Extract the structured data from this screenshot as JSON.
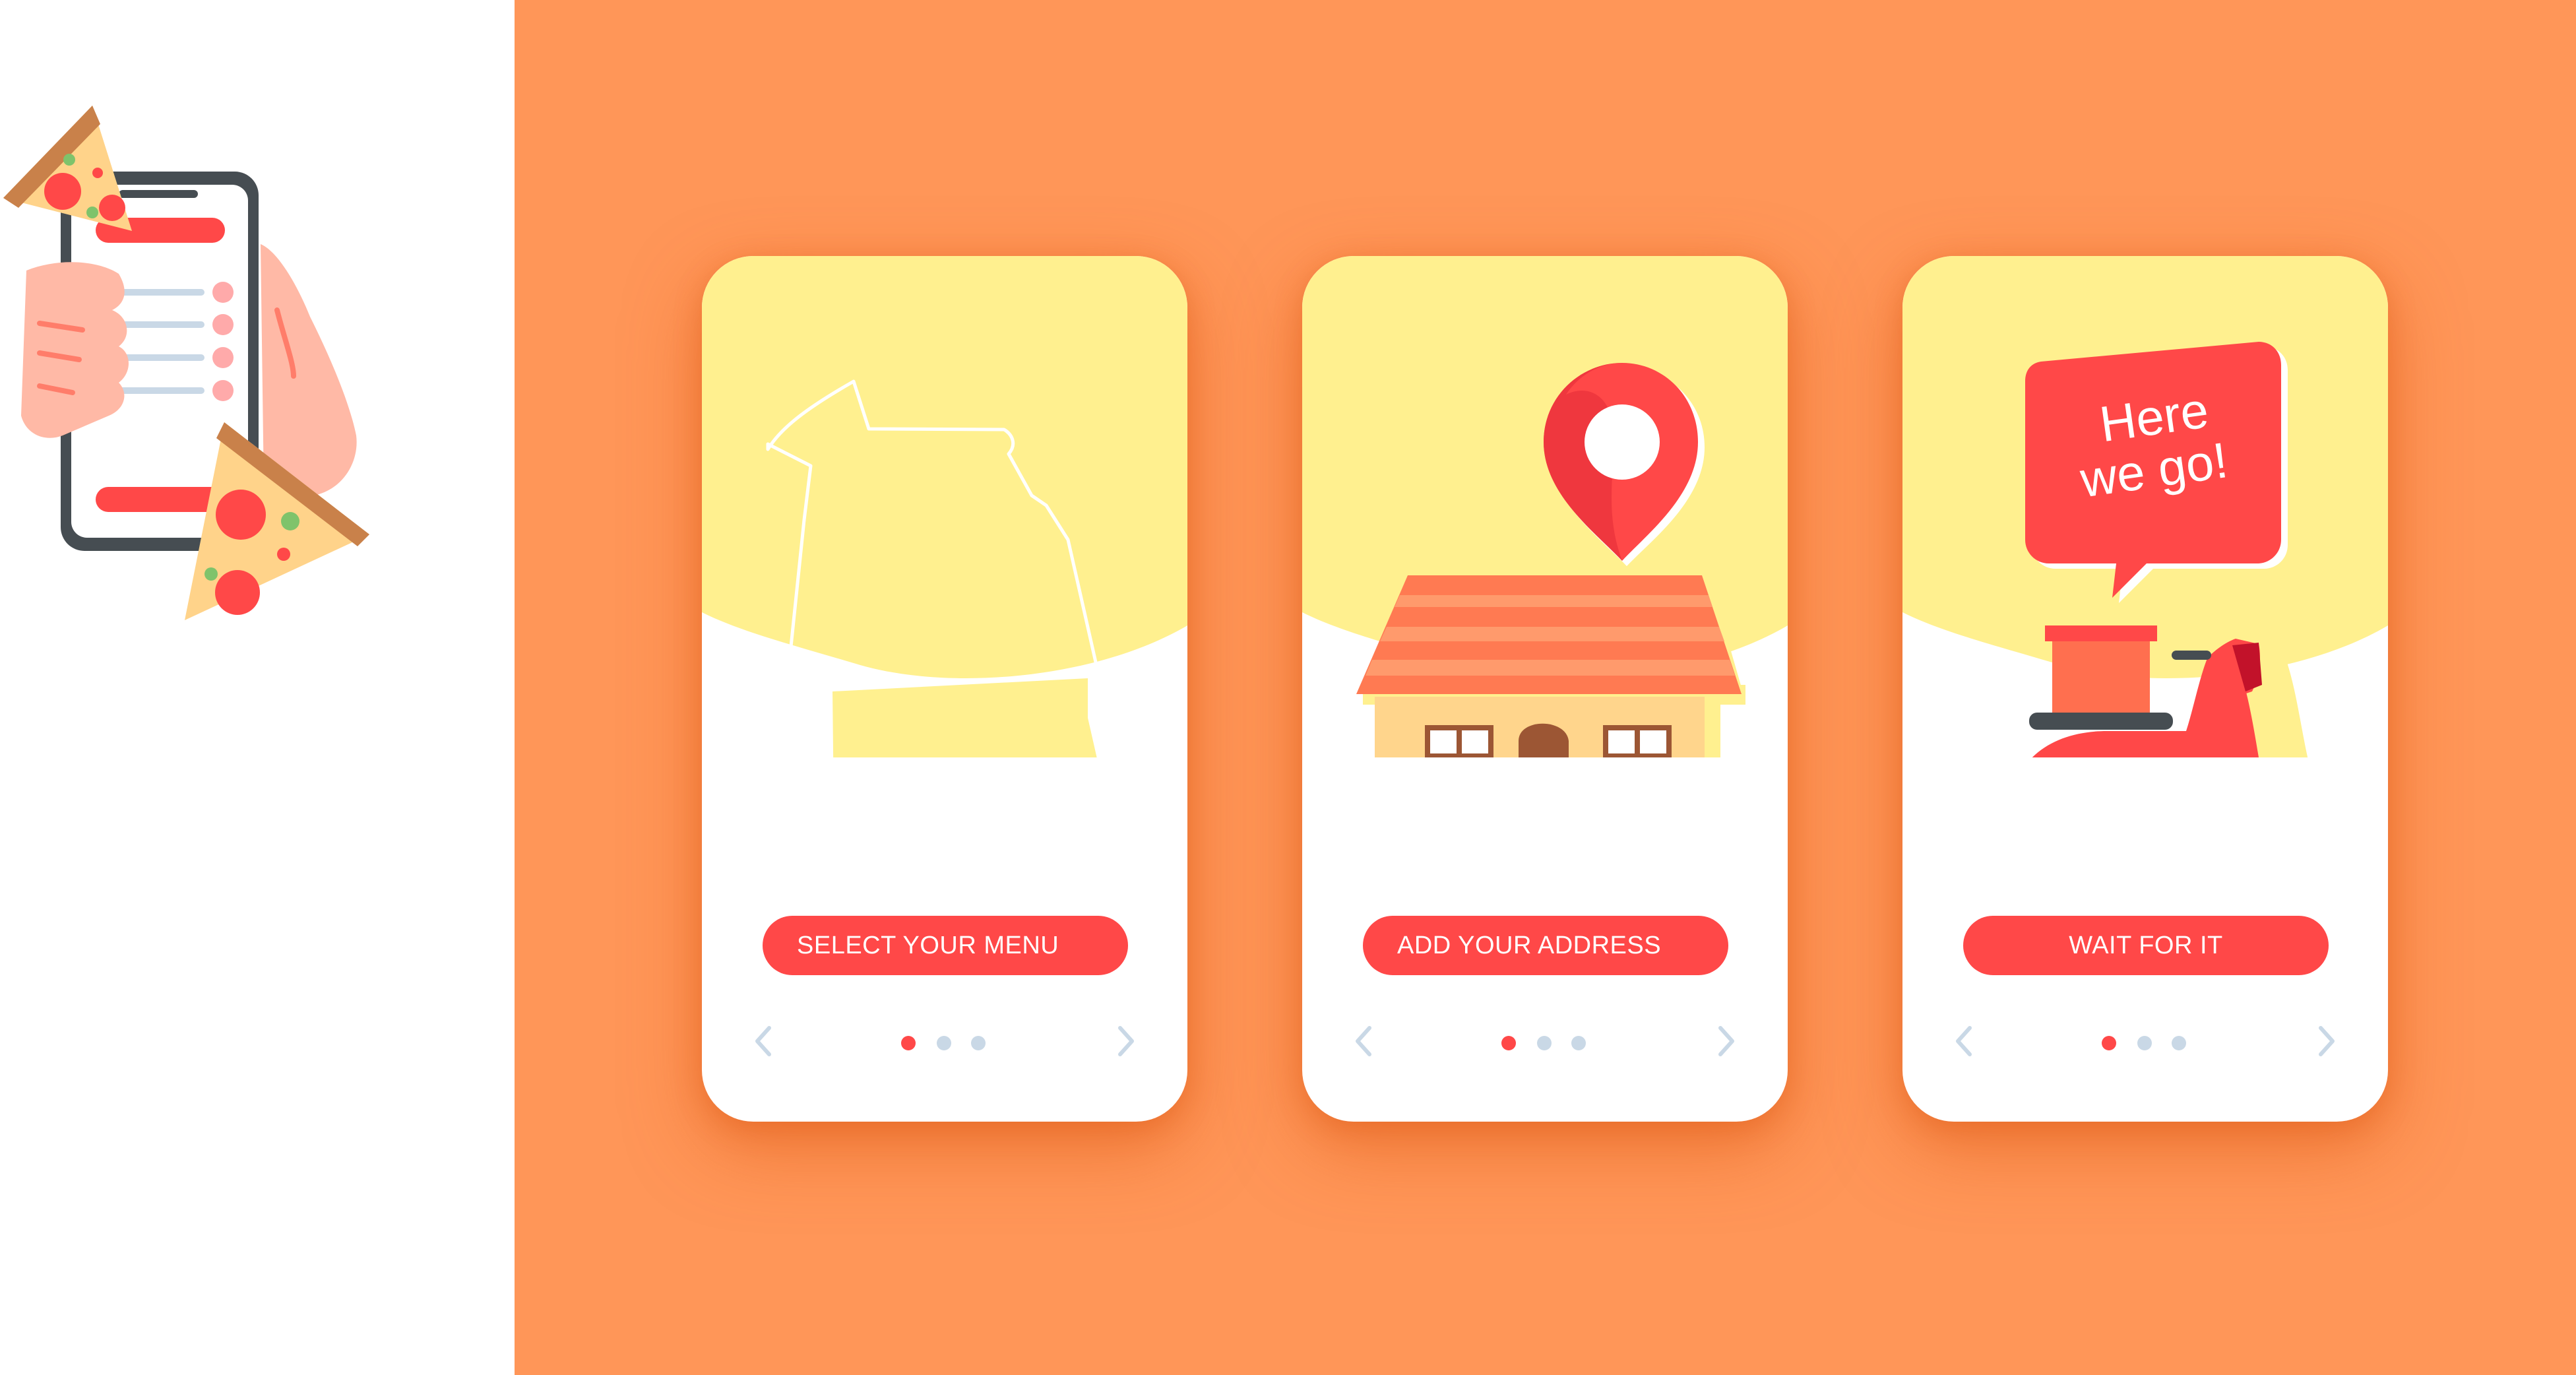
{
  "colors": {
    "background_orange": "#ff9658",
    "card_yellow": "#fff08f",
    "accent_red": "#ff4848",
    "dot_inactive": "#c9d8e6",
    "arrow_gray": "#c9d8e6"
  },
  "onboarding": {
    "cards": [
      {
        "id": "menu",
        "button_label": "SELECT YOUR MENU",
        "illustration_icon": "menu-bag-outline-icon",
        "active_page": 1,
        "total_pages": 3
      },
      {
        "id": "address",
        "button_label": "ADD YOUR ADDRESS",
        "illustration_icon": "house-with-location-pin-icon",
        "active_page": 1,
        "total_pages": 3
      },
      {
        "id": "wait",
        "button_label": "WAIT FOR IT",
        "illustration_icon": "delivery-scooter-icon",
        "speech_bubble": {
          "line1": "Here",
          "line2": "we go!"
        },
        "active_page": 1,
        "total_pages": 3
      }
    ]
  },
  "side_illustration": {
    "icon": "hand-holding-phone-with-pizza-icon"
  }
}
